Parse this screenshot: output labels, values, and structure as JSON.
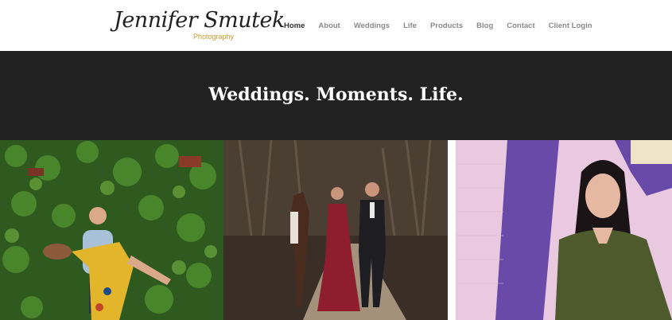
{
  "logo": {
    "script": "Jennifer Smutek",
    "sub": "Photography"
  },
  "nav": {
    "items": [
      "Home",
      "About",
      "Weddings",
      "Life",
      "Products",
      "Blog",
      "Contact",
      "Client Login"
    ],
    "active": "Home"
  },
  "hero": {
    "title": "Weddings. Moments. Life."
  },
  "colors": {
    "hero_bg": "#222222",
    "logo_accent": "#c39a30",
    "nav_active": "#333333",
    "nav_inactive": "#8a8a8a"
  },
  "gallery": {
    "photos": [
      {
        "name": "couple-ivy-wall-photo"
      },
      {
        "name": "couple-with-horse-photo"
      },
      {
        "name": "woman-purple-wall-photo"
      }
    ]
  }
}
